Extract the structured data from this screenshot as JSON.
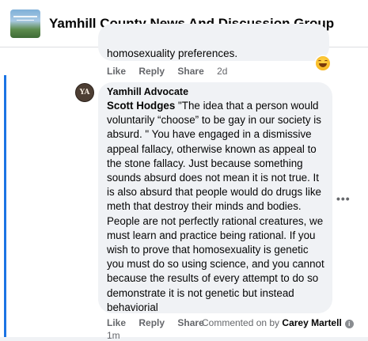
{
  "header": {
    "group_title": "Yamhill County News And Discussion Group",
    "group_avatar_icon": "group-cover-photo"
  },
  "previous_comment": {
    "text_tail": "homosexuality preferences.",
    "actions": {
      "like": "Like",
      "reply": "Reply",
      "share": "Share",
      "time": "2d"
    },
    "reaction_icon": "laughing-emoji"
  },
  "reply": {
    "avatar_initials": "YA",
    "author": "Yamhill Advocate",
    "tag": "Scott Hodges",
    "text": " \"The idea that a person would voluntarily “choose” to be gay in our society is absurd. \" You have engaged in a dismissive appeal fallacy, otherwise known as appeal to the stone fallacy. Just because something sounds absurd does not mean it is not true. It is also absurd that people would do drugs like meth that destroy their minds and bodies. People are not perfectly rational creatures, we must learn and practice being rational. If you wish to prove that homosexuality is genetic you must do so using science, and you cannot because the results of every attempt to do so demonstrate it is not genetic but instead behaviorial",
    "more_icon": "•••",
    "actions": {
      "like": "Like",
      "reply": "Reply",
      "share": "Share"
    },
    "commented_on_label": "Commented on by",
    "commented_on_name": "Carey Martell",
    "info_icon": "i",
    "time": "1m"
  },
  "colors": {
    "thread_line": "#1b74e4",
    "bubble": "#f0f2f5",
    "secondary_text": "#65676b"
  }
}
